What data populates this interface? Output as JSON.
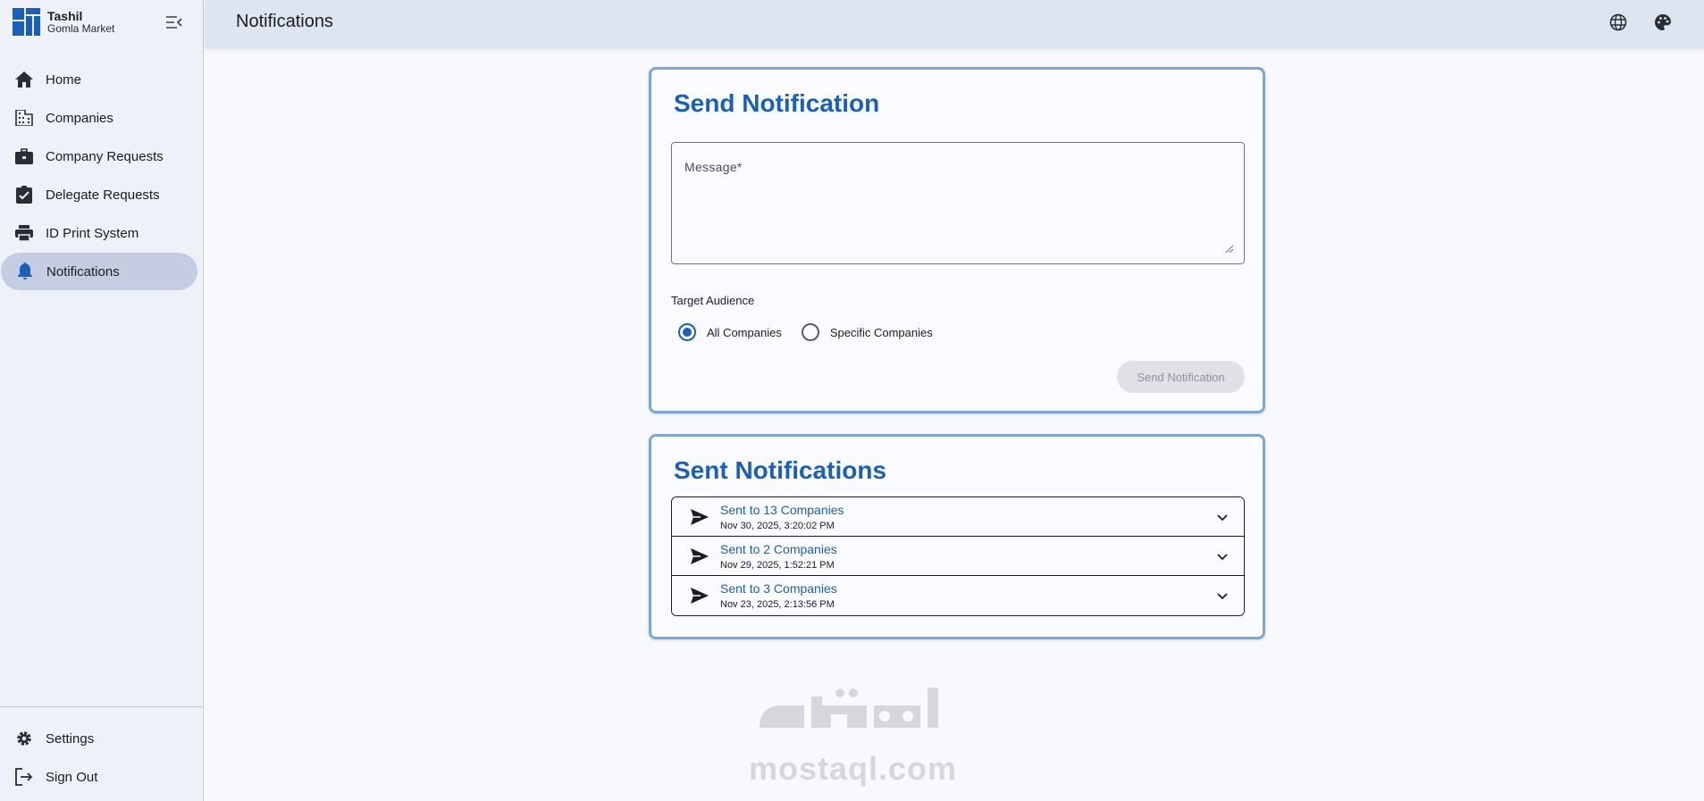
{
  "brand": {
    "title": "Tashil",
    "subtitle": "Gomla Market",
    "logo_color": "#1a5fb8"
  },
  "sidebar": {
    "items": [
      {
        "label": "Home",
        "icon": "home-icon"
      },
      {
        "label": "Companies",
        "icon": "building-icon"
      },
      {
        "label": "Company Requests",
        "icon": "briefcase-icon"
      },
      {
        "label": "Delegate Requests",
        "icon": "clipboard-check-icon"
      },
      {
        "label": "ID Print System",
        "icon": "printer-icon"
      },
      {
        "label": "Notifications",
        "icon": "bell-icon",
        "active": true
      }
    ],
    "bottom_items": [
      {
        "label": "Settings",
        "icon": "gear-icon"
      },
      {
        "label": "Sign Out",
        "icon": "logout-icon"
      }
    ]
  },
  "header": {
    "title": "Notifications"
  },
  "send_card": {
    "title": "Send Notification",
    "message_label": "Message",
    "message_required": "*",
    "message_value": "",
    "target_label": "Target Audience",
    "options": [
      {
        "label": "All Companies",
        "selected": true
      },
      {
        "label": "Specific Companies",
        "selected": false
      }
    ],
    "button_label": "Send Notification"
  },
  "sent_card": {
    "title": "Sent Notifications",
    "items": [
      {
        "title": "Sent to 13 Companies",
        "date": "Nov 30, 2025, 3:20:02 PM"
      },
      {
        "title": "Sent to 2 Companies",
        "date": "Nov 29, 2025, 1:52:21 PM"
      },
      {
        "title": "Sent to 3 Companies",
        "date": "Nov 23, 2025, 2:13:56 PM"
      }
    ]
  },
  "watermark": {
    "arabic": "مستقل",
    "latin": "mostaql.com"
  },
  "colors": {
    "accent": "#1a5fb8",
    "card_border": "#7aa6d8",
    "active_nav": "#c5cde2"
  }
}
